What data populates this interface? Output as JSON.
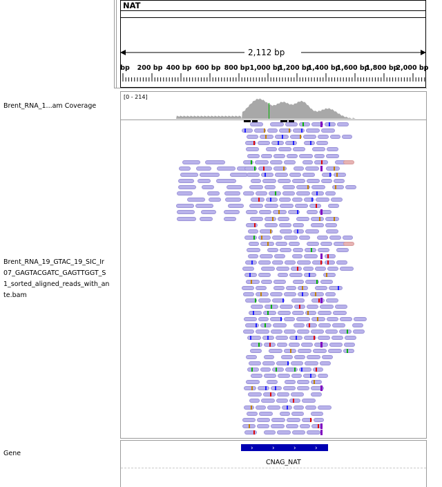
{
  "reference": {
    "name": "NAT"
  },
  "ruler": {
    "span_label": "2,112 bp",
    "ticks": [
      "bp",
      "200 bp",
      "400 bp",
      "600 bp",
      "800 bp",
      "1,000 bp",
      "1,200 bp",
      "1,400 bp",
      "1,600 bp",
      "1,800 bp",
      "2,000 bp"
    ]
  },
  "tracks": {
    "coverage": {
      "name": "Brent_RNA_1...am Coverage",
      "range": "[0 - 214]"
    },
    "alignment": {
      "name_lines": [
        "Brent_RNA_19_GTAC_19_SIC_Ir",
        "07_GAGTACGATC_GAGTTGGT_S",
        "1_sorted_aligned_reads_with_an",
        "te.bam"
      ]
    },
    "gene": {
      "name": "Gene",
      "feature_label": "CNAG_NAT"
    }
  },
  "colors": {
    "read": "#b9b3ea",
    "read_outline": "#9a92d8",
    "soft_clip_read": "#e6b3b3",
    "coverage": "#a8a8a8",
    "gene_feature": "#0000b2",
    "mismatch_a": "#00b000",
    "mismatch_c": "#2020ff",
    "mismatch_g": "#c08000",
    "mismatch_t": "#e00000",
    "insertion": "#8000c0"
  },
  "icons": {
    "ruler_arrows": "double-headed-arrow",
    "strand_markers": "chevron-right"
  }
}
